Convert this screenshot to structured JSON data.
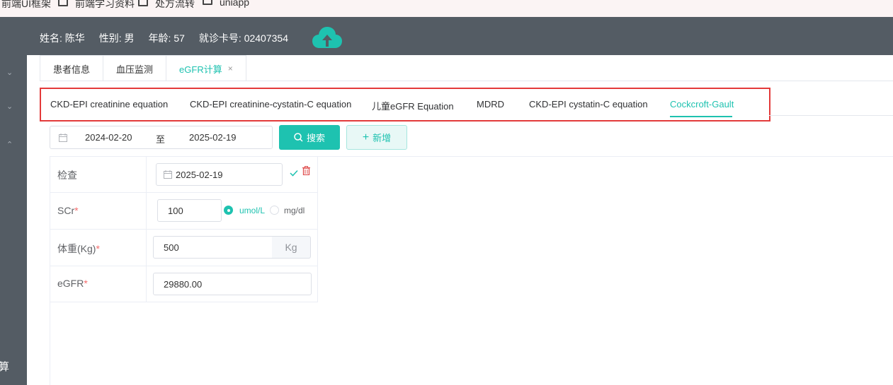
{
  "bookmarks": [
    {
      "label": "前端UI框架"
    },
    {
      "label": "前端学习资料"
    },
    {
      "label": "处方流转"
    },
    {
      "label": "uniapp"
    }
  ],
  "patient": {
    "name": "姓名: 陈华",
    "gender": "性别: 男",
    "age": "年龄: 57",
    "card": "就诊卡号: 02407354"
  },
  "sidebar": {
    "partial_text": "算"
  },
  "page_tabs": [
    {
      "label": "患者信息"
    },
    {
      "label": "血压监测"
    },
    {
      "label": "eGFR计算",
      "close": "×"
    }
  ],
  "formula_tabs": [
    {
      "label": "CKD-EPI creatinine equation"
    },
    {
      "label": "CKD-EPI creatinine-cystatin-C equation"
    },
    {
      "label": "儿童eGFR Equation"
    },
    {
      "label": "MDRD"
    },
    {
      "label": "CKD-EPI cystatin-C equation"
    },
    {
      "label": "Cockcroft-Gault"
    }
  ],
  "search": {
    "start_date": "2024-02-20",
    "separator": "至",
    "end_date": "2025-02-19",
    "search_label": "搜索",
    "add_label": "新增"
  },
  "form": {
    "exam": {
      "label": "检查",
      "date": "2025-02-19"
    },
    "scr": {
      "label": "SCr",
      "required": "*",
      "value": "100",
      "unit_options": [
        "umol/L",
        "mg/dl"
      ],
      "selected_unit": "umol/L"
    },
    "weight": {
      "label": "体重(Kg)",
      "required": "*",
      "value": "500",
      "unit": "Kg"
    },
    "egfr": {
      "label": "eGFR",
      "required": "*",
      "value": "29880.00"
    }
  },
  "colors": {
    "accent": "#1ec2b0",
    "header_bg": "#545c64",
    "highlight_border": "#e33a3a",
    "delete": "#e05050"
  }
}
